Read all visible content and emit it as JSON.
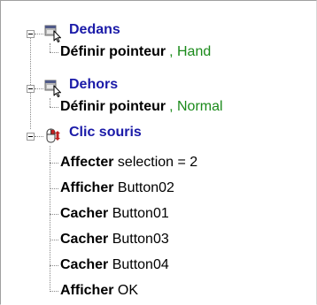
{
  "tree": {
    "events": [
      {
        "label": "Dedans",
        "icon": "pointer-window-icon",
        "actions": [
          {
            "name": "Définir pointeur",
            "param": ", Hand"
          }
        ]
      },
      {
        "label": "Dehors",
        "icon": "pointer-window-icon",
        "actions": [
          {
            "name": "Définir pointeur",
            "param": ", Normal"
          }
        ]
      },
      {
        "label": "Clic souris",
        "icon": "mouse-click-icon",
        "actions": [
          {
            "name": "Affecter",
            "param": " selection = 2"
          },
          {
            "name": "Afficher",
            "param": " Button02"
          },
          {
            "name": "Cacher",
            "param": " Button01"
          },
          {
            "name": "Cacher",
            "param": " Button03"
          },
          {
            "name": "Cacher",
            "param": " Button04"
          },
          {
            "name": "Afficher",
            "param": " OK"
          }
        ]
      }
    ]
  },
  "colors": {
    "event_text": "#1a1aa8",
    "param_green": "#1a8a1a",
    "action_text": "#000000",
    "tree_lines": "#8a8a8a"
  }
}
